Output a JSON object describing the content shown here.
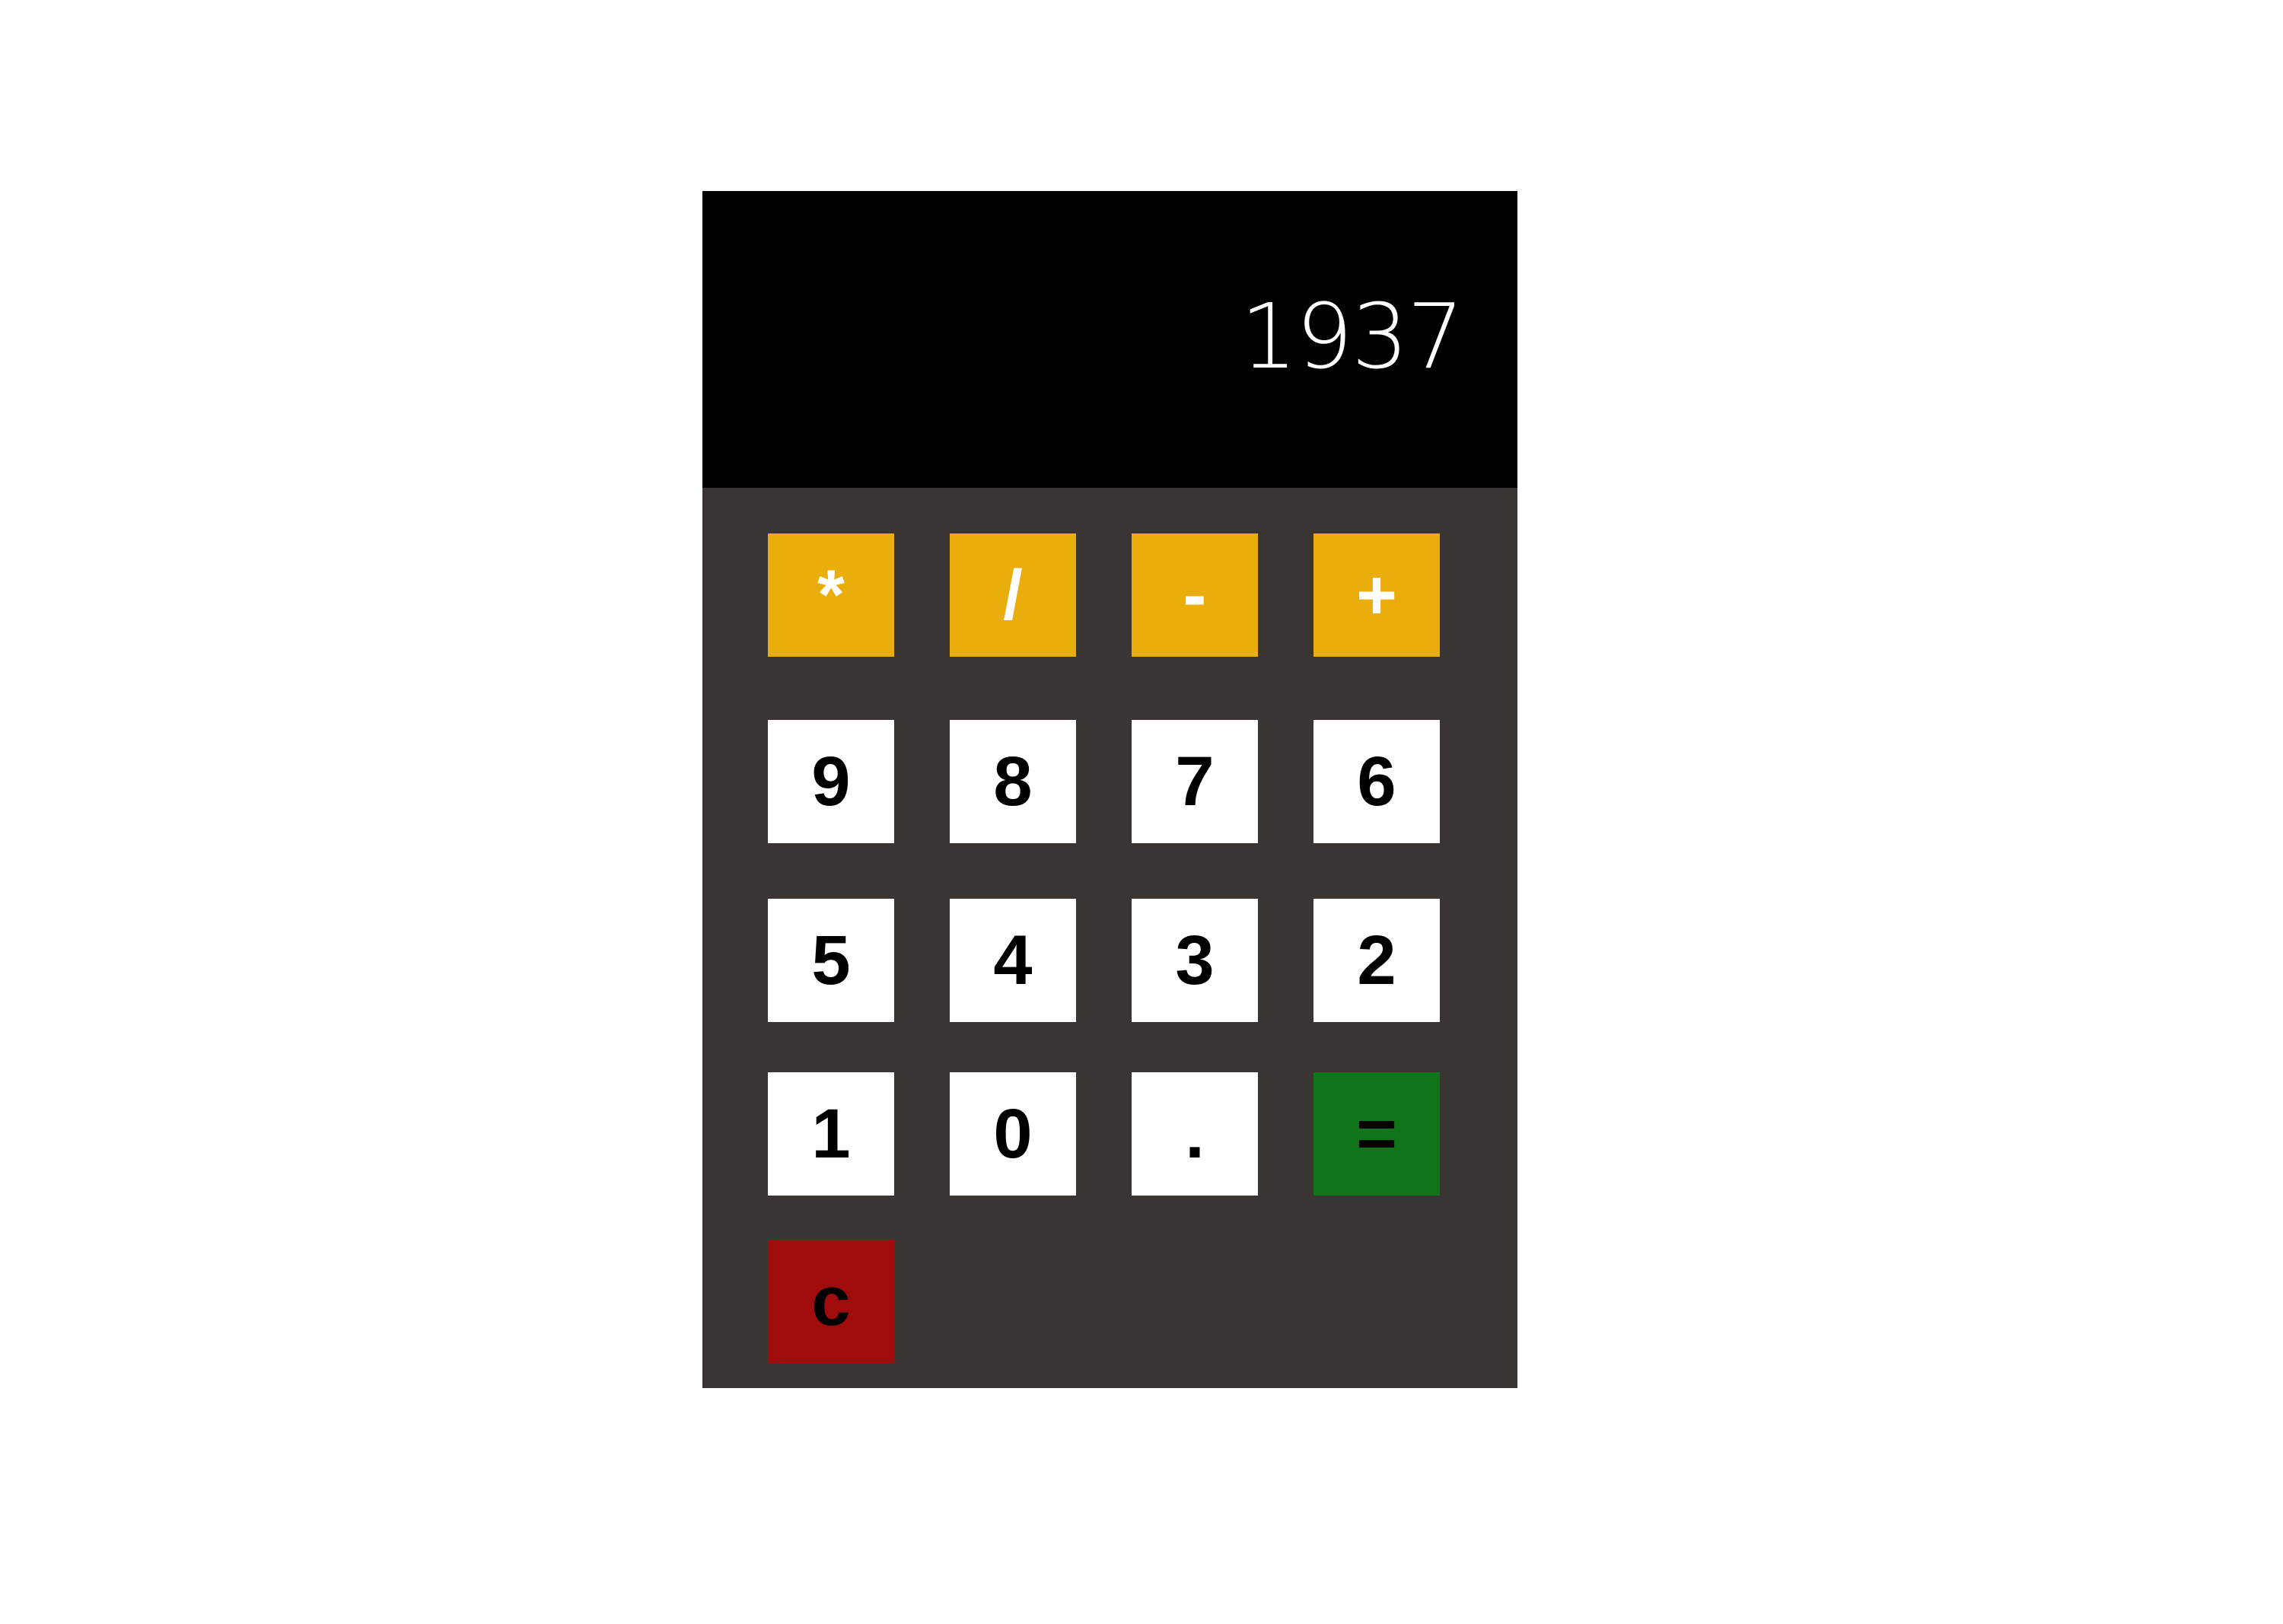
{
  "display": {
    "value": "1937"
  },
  "colors": {
    "body": "#3a3533",
    "display": "#000000",
    "operator": "#e9ae0c",
    "number": "#ffffff",
    "equals": "#0f741a",
    "clear": "#a00b0b"
  },
  "keys": {
    "multiply": "*",
    "divide": "/",
    "subtract": "-",
    "add": "+",
    "nine": "9",
    "eight": "8",
    "seven": "7",
    "six": "6",
    "five": "5",
    "four": "4",
    "three": "3",
    "two": "2",
    "one": "1",
    "zero": "0",
    "decimal": ".",
    "equals": "=",
    "clear": "c"
  }
}
